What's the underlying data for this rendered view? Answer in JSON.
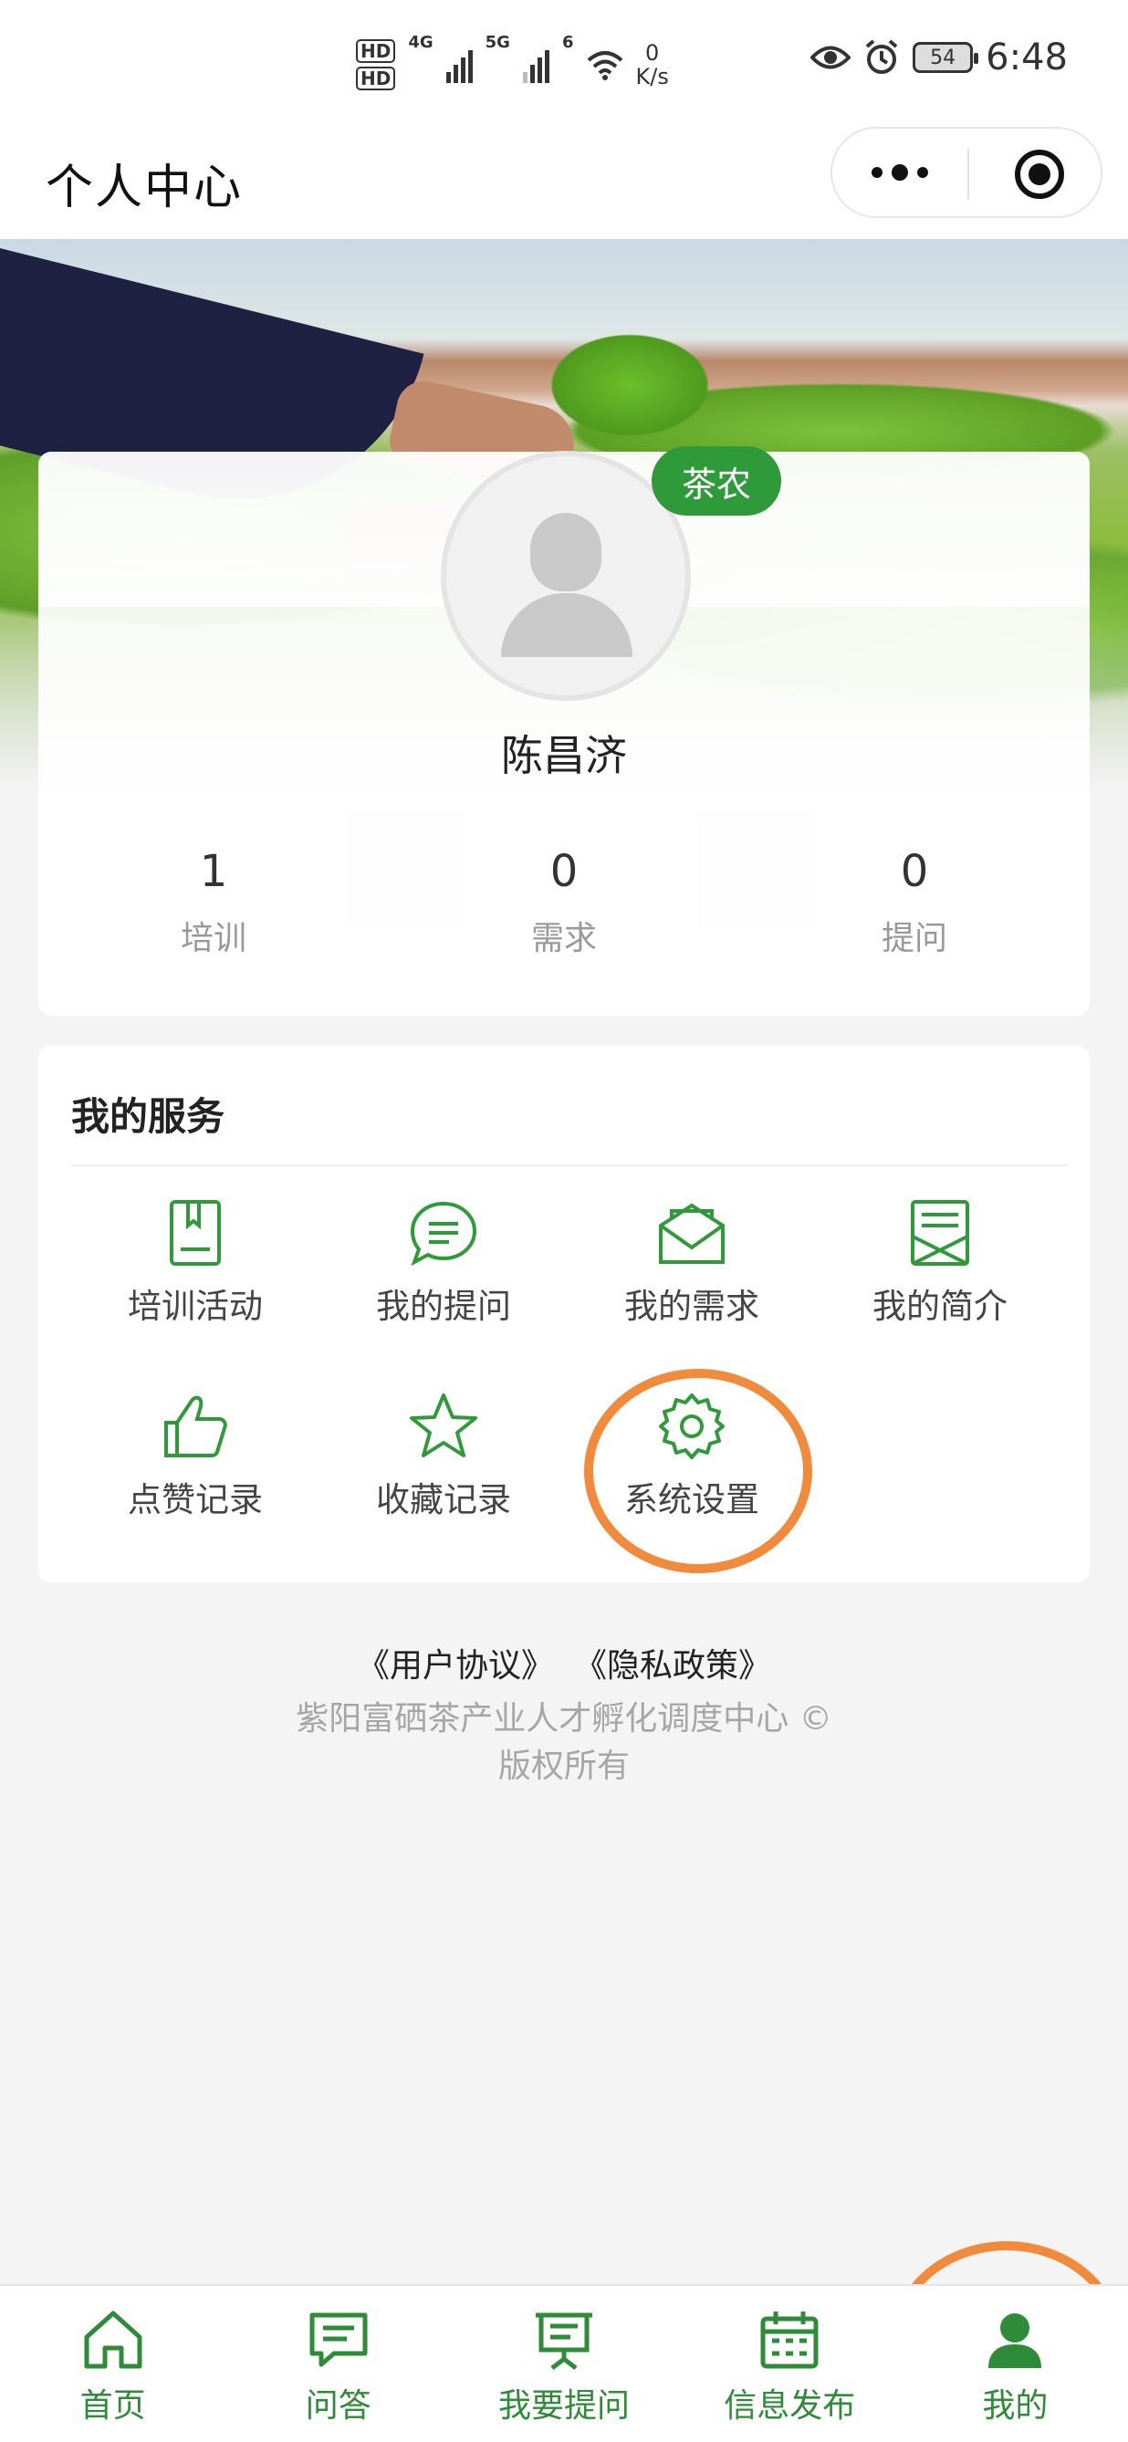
{
  "status_bar": {
    "hd1": "HD",
    "hd2": "HD",
    "net1": "4G",
    "net2": "5G",
    "wifi": "6",
    "speed_value": "0",
    "speed_unit": "K/s",
    "battery": "54",
    "time": "6:48"
  },
  "nav": {
    "title": "个人中心"
  },
  "profile": {
    "role": "茶农",
    "name": "陈昌济",
    "stats": [
      {
        "value": "1",
        "label": "培训"
      },
      {
        "value": "0",
        "label": "需求"
      },
      {
        "value": "0",
        "label": "提问"
      }
    ]
  },
  "services": {
    "title": "我的服务",
    "items": [
      {
        "label": "培训活动",
        "icon": "book-icon"
      },
      {
        "label": "我的提问",
        "icon": "chat-bubble-icon"
      },
      {
        "label": "我的需求",
        "icon": "envelope-icon"
      },
      {
        "label": "我的简介",
        "icon": "profile-doc-icon"
      },
      {
        "label": "点赞记录",
        "icon": "thumbs-up-icon"
      },
      {
        "label": "收藏记录",
        "icon": "star-icon"
      },
      {
        "label": "系统设置",
        "icon": "gear-icon"
      }
    ]
  },
  "footer": {
    "user_agreement": "《用户协议》",
    "privacy_policy": "《隐私政策》",
    "copyright_line1": "紫阳富硒茶产业人才孵化调度中心 ©",
    "copyright_line2": "版权所有"
  },
  "tabbar": {
    "items": [
      {
        "label": "首页",
        "icon": "home-icon"
      },
      {
        "label": "问答",
        "icon": "chat-icon"
      },
      {
        "label": "我要提问",
        "icon": "presentation-icon"
      },
      {
        "label": "信息发布",
        "icon": "calendar-icon"
      },
      {
        "label": "我的",
        "icon": "user-icon",
        "active": true
      }
    ]
  },
  "colors": {
    "primary_green": "#2e9a3a",
    "highlight_orange": "#f28a3c"
  }
}
